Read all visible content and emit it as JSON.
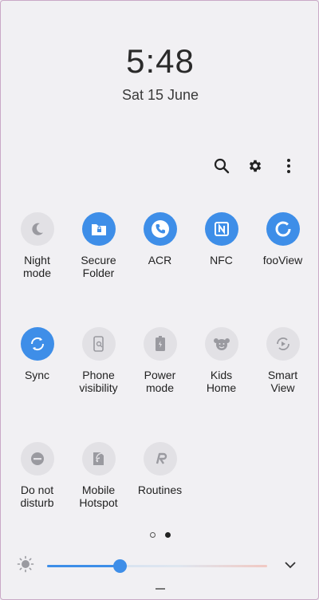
{
  "clock": {
    "time": "5:48",
    "date": "Sat 15 June"
  },
  "toolbar": {
    "icons": [
      "search-icon",
      "gear-icon",
      "more-vertical-icon"
    ]
  },
  "tiles": [
    {
      "label": "Night\nmode",
      "icon": "moon-icon",
      "on": false
    },
    {
      "label": "Secure\nFolder",
      "icon": "folder-lock-icon",
      "on": true
    },
    {
      "label": "ACR",
      "icon": "phone-icon",
      "on": true
    },
    {
      "label": "NFC",
      "icon": "nfc-icon",
      "on": true
    },
    {
      "label": "fooView",
      "icon": "ring-icon",
      "on": true
    },
    {
      "label": "Sync",
      "icon": "sync-icon",
      "on": true
    },
    {
      "label": "Phone\nvisibility",
      "icon": "phone-search-icon",
      "on": false
    },
    {
      "label": "Power\nmode",
      "icon": "battery-icon",
      "on": false
    },
    {
      "label": "Kids\nHome",
      "icon": "kids-face-icon",
      "on": false
    },
    {
      "label": "Smart\nView",
      "icon": "smart-view-icon",
      "on": false
    },
    {
      "label": "Do not\ndisturb",
      "icon": "minus-circle-icon",
      "on": false
    },
    {
      "label": "Mobile\nHotspot",
      "icon": "hotspot-icon",
      "on": false
    },
    {
      "label": "Routines",
      "icon": "routines-icon",
      "on": false
    }
  ],
  "pager": {
    "pages": 2,
    "current": 2
  },
  "brightness": {
    "level": 0.33,
    "icon": "sun-icon"
  },
  "colors": {
    "accent": "#3e8ee8",
    "tile_off": "#e2e1e5",
    "background": "#f1f0f3"
  }
}
